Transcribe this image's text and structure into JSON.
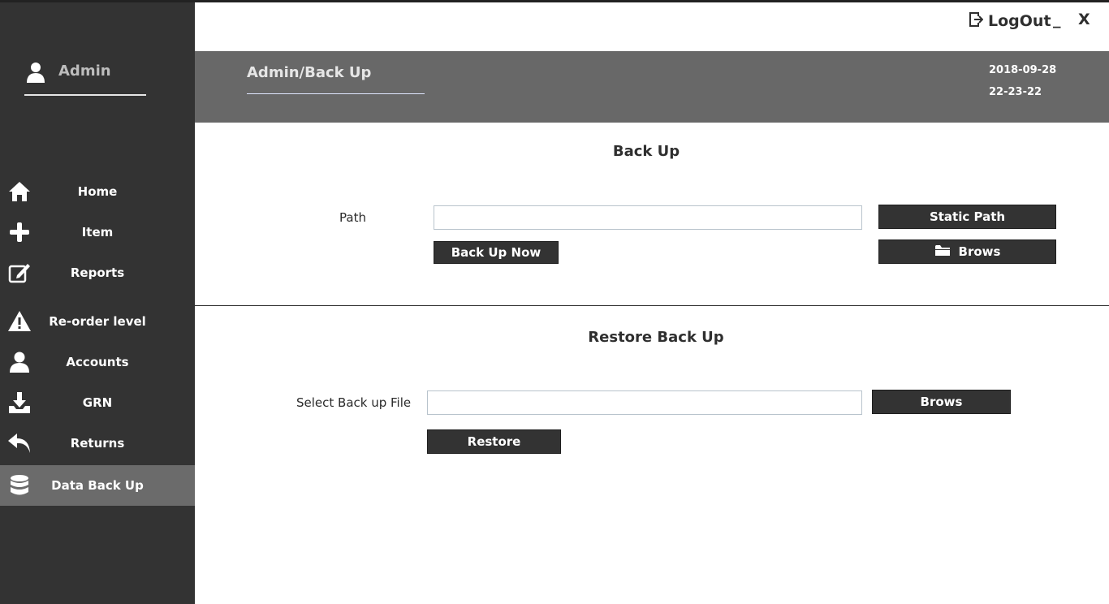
{
  "sidebar": {
    "user": {
      "name": "Admin",
      "icon": "user-icon"
    },
    "items": [
      {
        "label": "Home",
        "icon": "home-icon",
        "active": false
      },
      {
        "label": "Item",
        "icon": "plus-icon",
        "active": false
      },
      {
        "label": "Reports",
        "icon": "edit-icon",
        "active": false
      },
      {
        "label": "Re-order level",
        "icon": "warning-icon",
        "active": false
      },
      {
        "label": "Accounts",
        "icon": "user-icon",
        "active": false
      },
      {
        "label": "GRN",
        "icon": "download-tray-icon",
        "active": false
      },
      {
        "label": "Returns",
        "icon": "reply-icon",
        "active": false
      },
      {
        "label": "Data Back Up",
        "icon": "database-icon",
        "active": true
      }
    ]
  },
  "topbar": {
    "logout_label": "LogOut",
    "minimize_label": "_",
    "close_label": "X"
  },
  "header": {
    "breadcrumb": "Admin/Back Up",
    "date": "2018-09-28",
    "time": "22-23-22"
  },
  "backup": {
    "title": "Back Up",
    "path_label": "Path",
    "path_value": "",
    "static_path_button": "Static Path",
    "backup_now_button": "Back Up Now",
    "browse_button": "Brows"
  },
  "restore": {
    "title": "Restore Back Up",
    "file_label": "Select Back up File",
    "file_value": "",
    "browse_button": "Brows",
    "restore_button": "Restore"
  },
  "colors": {
    "sidebar_bg": "#333333",
    "active_item_bg": "#6b6b6b",
    "header_bg": "#686868",
    "button_bg": "#333333"
  }
}
